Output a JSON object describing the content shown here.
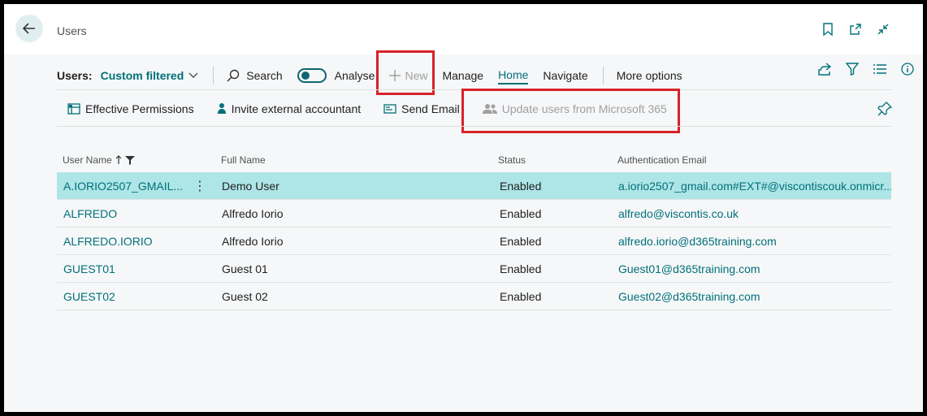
{
  "header": {
    "title": "Users",
    "icons": [
      "back-arrow-icon",
      "bookmark-icon",
      "open-new-window-icon",
      "collapse-icon"
    ]
  },
  "actionbar": {
    "label": "Users:",
    "filter": "Custom filtered",
    "search": "Search",
    "analyse": "Analyse",
    "new": "New",
    "manage": "Manage",
    "home": "Home",
    "navigate": "Navigate",
    "more": "More options"
  },
  "subbar": {
    "effective_permissions": "Effective Permissions",
    "invite": "Invite external accountant",
    "send_email": "Send Email",
    "update_users": "Update users from Microsoft 365"
  },
  "table": {
    "columns": [
      "User Name",
      "Full Name",
      "Status",
      "Authentication Email"
    ],
    "rows": [
      {
        "user": "A.IORIO2507_GMAIL...",
        "full": "Demo User",
        "status": "Enabled",
        "email": "a.iorio2507_gmail.com#EXT#@viscontiscouk.onmicr..."
      },
      {
        "user": "ALFREDO",
        "full": "Alfredo Iorio",
        "status": "Enabled",
        "email": "alfredo@viscontis.co.uk"
      },
      {
        "user": "ALFREDO.IORIO",
        "full": "Alfredo Iorio",
        "status": "Enabled",
        "email": "alfredo.iorio@d365training.com"
      },
      {
        "user": "GUEST01",
        "full": "Guest 01",
        "status": "Enabled",
        "email": "Guest01@d365training.com"
      },
      {
        "user": "GUEST02",
        "full": "Guest 02",
        "status": "Enabled",
        "email": "Guest02@d365training.com"
      }
    ]
  },
  "colors": {
    "accent": "#00707a",
    "highlight": "#d6232a",
    "selected_row": "#aee5e6"
  }
}
